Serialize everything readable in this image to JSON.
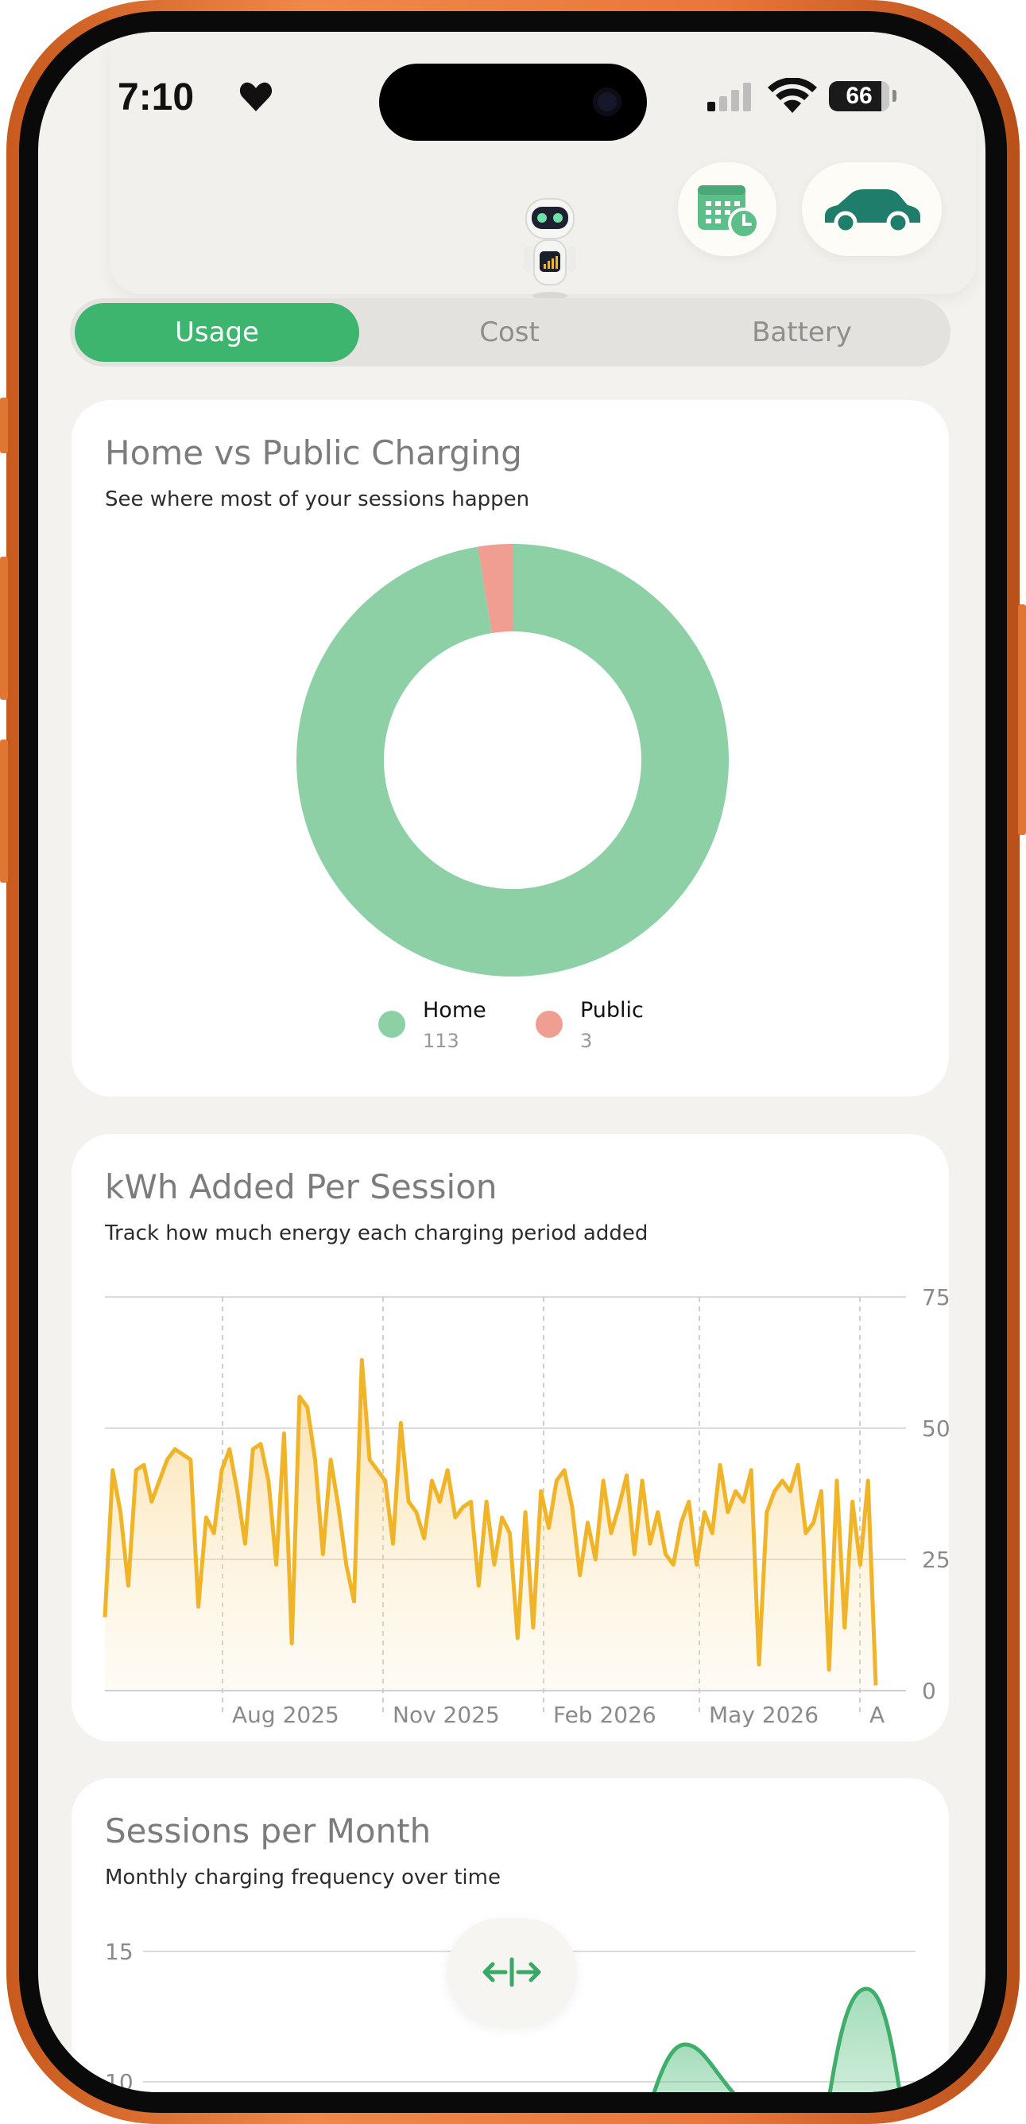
{
  "status": {
    "time": "7:10",
    "battery": "66"
  },
  "header": {
    "robot": "robot-icon",
    "calendar": "calendar-clock-icon",
    "vehicle": "car-icon"
  },
  "tabs": [
    {
      "label": "Usage",
      "active": true
    },
    {
      "label": "Cost",
      "active": false
    },
    {
      "label": "Battery",
      "active": false
    }
  ],
  "home_public": {
    "title": "Home vs Public Charging",
    "subtitle": "See where most of your sessions happen",
    "legend": [
      {
        "name": "Home",
        "value": "113",
        "color": "#8dd0a6"
      },
      {
        "name": "Public",
        "value": "3",
        "color": "#f09d92"
      }
    ]
  },
  "kwh_per_session": {
    "title": "kWh Added Per Session",
    "subtitle": "Track how much energy each charging period added",
    "x_ticks": [
      "Aug 2025",
      "Nov 2025",
      "Feb 2026",
      "May 2026",
      "A"
    ],
    "y_ticks": [
      "75",
      "50",
      "25",
      "0"
    ]
  },
  "sessions_per_month": {
    "title": "Sessions per Month",
    "subtitle": "Monthly charging frequency over time",
    "y_ticks": [
      "15",
      "10"
    ]
  },
  "fab": {
    "icon": "expand-horizontal-icon"
  },
  "chart_data": [
    {
      "type": "pie",
      "labels": [
        "Home",
        "Public"
      ],
      "values": [
        113,
        3
      ],
      "colors": [
        "#8dd0a6",
        "#f09d92"
      ],
      "donut": true
    },
    {
      "type": "area",
      "ylim": [
        0,
        75
      ],
      "yticks": [
        0,
        25,
        50,
        75
      ],
      "xticks": [
        "Aug 2025",
        "Nov 2025",
        "Feb 2026",
        "May 2026",
        "A"
      ],
      "grid": true,
      "color": "#f0b429",
      "values": [
        14,
        42,
        34,
        20,
        42,
        43,
        36,
        40,
        44,
        46,
        45,
        44,
        16,
        33,
        30,
        42,
        46,
        38,
        28,
        46,
        47,
        40,
        24,
        49,
        9,
        56,
        54,
        44,
        26,
        44,
        35,
        24,
        17,
        63,
        44,
        42,
        40,
        28,
        51,
        36,
        34,
        29,
        40,
        36,
        42,
        33,
        35,
        36,
        20,
        36,
        24,
        33,
        30,
        10,
        34,
        12,
        38,
        31,
        40,
        42,
        35,
        22,
        32,
        25,
        40,
        30,
        35,
        41,
        26,
        40,
        28,
        34,
        26,
        24,
        32,
        36,
        24,
        34,
        30,
        43,
        34,
        38,
        36,
        42,
        5,
        34,
        38,
        40,
        38,
        43,
        30,
        32,
        38,
        4,
        40,
        12,
        36,
        24,
        40,
        1
      ]
    },
    {
      "type": "area",
      "ylim": [
        7,
        15
      ],
      "yticks": [
        10,
        15
      ],
      "color": "#3fae6a",
      "values": []
    }
  ]
}
